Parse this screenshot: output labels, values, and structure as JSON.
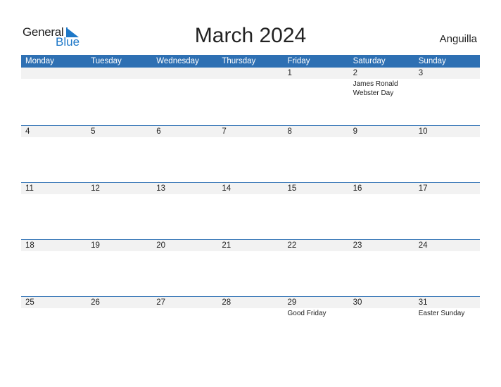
{
  "logo": {
    "general": "General",
    "blue": "Blue"
  },
  "title": "March 2024",
  "country": "Anguilla",
  "colors": {
    "header": "#2e70b3",
    "accent": "#1e78c8",
    "band": "#f2f2f2"
  },
  "weekdays": [
    "Monday",
    "Tuesday",
    "Wednesday",
    "Thursday",
    "Friday",
    "Saturday",
    "Sunday"
  ],
  "weeks": [
    [
      {
        "day": ""
      },
      {
        "day": ""
      },
      {
        "day": ""
      },
      {
        "day": ""
      },
      {
        "day": "1"
      },
      {
        "day": "2",
        "event": "James Ronald Webster Day"
      },
      {
        "day": "3"
      }
    ],
    [
      {
        "day": "4"
      },
      {
        "day": "5"
      },
      {
        "day": "6"
      },
      {
        "day": "7"
      },
      {
        "day": "8"
      },
      {
        "day": "9"
      },
      {
        "day": "10"
      }
    ],
    [
      {
        "day": "11"
      },
      {
        "day": "12"
      },
      {
        "day": "13"
      },
      {
        "day": "14"
      },
      {
        "day": "15"
      },
      {
        "day": "16"
      },
      {
        "day": "17"
      }
    ],
    [
      {
        "day": "18"
      },
      {
        "day": "19"
      },
      {
        "day": "20"
      },
      {
        "day": "21"
      },
      {
        "day": "22"
      },
      {
        "day": "23"
      },
      {
        "day": "24"
      }
    ],
    [
      {
        "day": "25"
      },
      {
        "day": "26"
      },
      {
        "day": "27"
      },
      {
        "day": "28"
      },
      {
        "day": "29",
        "event": "Good Friday"
      },
      {
        "day": "30"
      },
      {
        "day": "31",
        "event": "Easter Sunday"
      }
    ]
  ]
}
